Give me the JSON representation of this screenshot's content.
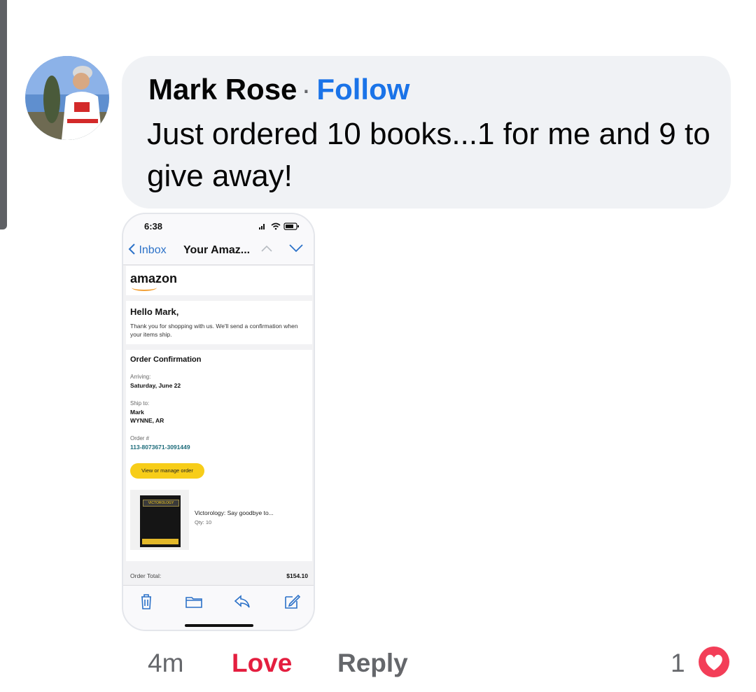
{
  "comment": {
    "author": "Mark Rose",
    "separator": "·",
    "follow_label": "Follow",
    "text": "Just ordered 10 books...1 for me and 9 to give away!",
    "time_ago": "4m",
    "reaction_label": "Love",
    "reply_label": "Reply",
    "reaction_count": "1",
    "reaction_type": "love-icon",
    "accent_color": "#1a73e8",
    "love_color": "#e41e3f"
  },
  "attachment": {
    "status_bar": {
      "time": "6:38",
      "icons": [
        "signal-icon",
        "wifi-icon",
        "battery-icon"
      ]
    },
    "nav": {
      "back_label": "Inbox",
      "subject": "Your Amaz..."
    },
    "email": {
      "logo_text": "amazon",
      "greeting": "Hello Mark,",
      "body": "Thank you for shopping with us. We'll send a confirmation when your items ship.",
      "section_title": "Order Confirmation",
      "arriving_label": "Arriving:",
      "arriving_value": "Saturday, June 22",
      "ship_to_label": "Ship to:",
      "ship_to_name": "Mark",
      "ship_to_city": "WYNNE, AR",
      "order_label": "Order #",
      "order_number": "113-8073671-3091449",
      "manage_button": "View or manage order",
      "item": {
        "cover_title": "VICTOROLOGY",
        "name": "Victorology: Say goodbye to...",
        "qty": "Qty: 10"
      },
      "total_label": "Order Total:",
      "total_value": "$154.10"
    },
    "toolbar_icons": [
      "trash-icon",
      "folder-icon",
      "reply-icon",
      "compose-icon"
    ]
  }
}
